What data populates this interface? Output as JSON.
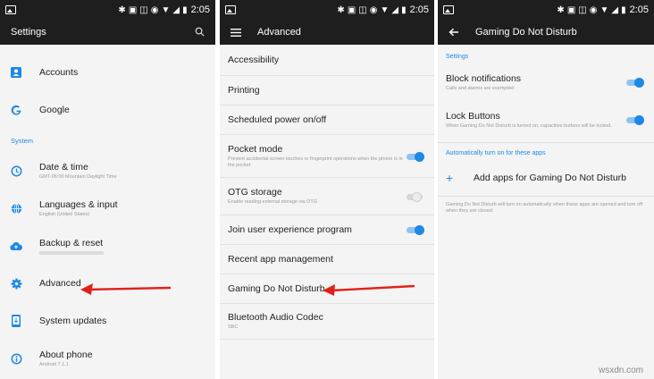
{
  "status": {
    "time": "2:05"
  },
  "panel1": {
    "title": "Settings",
    "items_top": [
      {
        "label": "Accounts",
        "icon": "accounts-icon"
      },
      {
        "label": "Google",
        "icon": "google-icon"
      }
    ],
    "section": "System",
    "items_system": [
      {
        "label": "Date & time",
        "sub": "GMT-06:00 Mountain Daylight Time",
        "icon": "clock-icon"
      },
      {
        "label": "Languages & input",
        "sub": "English (United States)",
        "icon": "globe-icon"
      },
      {
        "label": "Backup & reset",
        "sub": "",
        "icon": "cloud-upload-icon"
      },
      {
        "label": "Advanced",
        "sub": "",
        "icon": "gear-icon"
      },
      {
        "label": "System updates",
        "sub": "",
        "icon": "phone-update-icon"
      },
      {
        "label": "About phone",
        "sub": "Android 7.1.1",
        "icon": "info-icon"
      }
    ]
  },
  "panel2": {
    "title": "Advanced",
    "items": [
      {
        "label": "Accessibility"
      },
      {
        "label": "Printing"
      },
      {
        "label": "Scheduled power on/off"
      },
      {
        "label": "Pocket mode",
        "sub": "Prevent accidental screen touches or fingerprint operations when the phone is in the pocket",
        "toggle": true
      },
      {
        "label": "OTG storage",
        "sub": "Enable reading external storage via OTG",
        "toggle": false
      },
      {
        "label": "Join user experience program",
        "toggle": true
      },
      {
        "label": "Recent app management"
      },
      {
        "label": "Gaming Do Not Disturb"
      },
      {
        "label": "Bluetooth Audio Codec",
        "sub": "SBC"
      }
    ]
  },
  "panel3": {
    "title": "Gaming Do Not Disturb",
    "section1": "Settings",
    "block": {
      "label": "Block notifications",
      "sub": "Calls and alarms are exempted",
      "toggle": true
    },
    "lock": {
      "label": "Lock Buttons",
      "sub": "When Gaming Do Not Disturb is turned on, capacitive buttons will be locked.",
      "toggle": true
    },
    "section2": "Automatically turn on for these apps",
    "add_label": "Add apps for Gaming Do Not Disturb",
    "footnote": "Gaming Do Not Disturb will turn on automatically when these apps are opened and turn off when they are closed."
  },
  "watermark": "wsxdn.com",
  "colors": {
    "accent": "#1e88e5",
    "arrow": "#e0211b",
    "bar": "#1e1e1e"
  }
}
